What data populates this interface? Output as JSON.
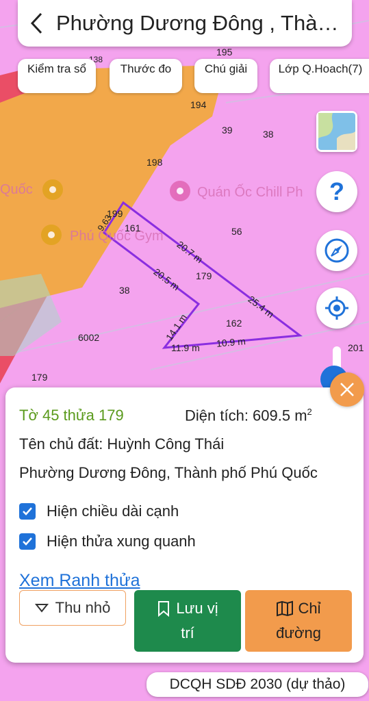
{
  "header": {
    "title": "Phường Dương Đông , Thàn..."
  },
  "chips": {
    "check_book": "Kiểm tra sổ",
    "measure": "Thước đo",
    "legend": "Chú giải",
    "layer": "Lớp Q.Hoach(7)"
  },
  "map": {
    "parcel_numbers": [
      "195",
      "194",
      "39",
      "38",
      "198",
      "199",
      "161",
      "56",
      "179",
      "38",
      "162",
      "6002",
      "201",
      "179",
      "138"
    ],
    "edge_lengths": [
      "20.7 m",
      "20.5 m",
      "25.4 m",
      "14.1 m",
      "11.9 m",
      "10.9 m",
      "9.63"
    ],
    "pois": [
      "Quán Ốc Chill Ph",
      "Phú Quốc Gym",
      "Quốc"
    ],
    "colors": {
      "land": "#f4a3ee",
      "road": "#f2a84a",
      "parcel_line": "#8a2ee0",
      "red_strip": "#e8404e"
    }
  },
  "right_buttons": {
    "help": "?",
    "icons": [
      "map-layer-icon",
      "help-icon",
      "compass-icon",
      "my-location-icon"
    ]
  },
  "sheet": {
    "sheet_number": "Tờ 45 thửa 179",
    "area_label": "Diện tích: 609.5 m",
    "area_unit_sup": "2",
    "owner": "Tên chủ đất: Huỳnh Công Thái",
    "address": "Phường Dương Đông, Thành phố Phú Quốc",
    "checkbox_edges": "Hiện chiều dài cạnh",
    "checkbox_neighbors": "Hiện thửa xung quanh",
    "view_boundary": "Xem Ranh thửa",
    "collapse": "Thu nhỏ",
    "save_line1": "Lưu vị",
    "save_line2": "trí",
    "direction_line1": "Chỉ",
    "direction_line2": "đường",
    "colors": {
      "accent_green": "#1e8a4c",
      "accent_orange": "#f29b4c",
      "link_blue": "#1f72d9",
      "sheet_title_green": "#5a9a1c"
    }
  },
  "footer": {
    "status": "DCQH SDĐ 2030 (dự thảo)"
  }
}
